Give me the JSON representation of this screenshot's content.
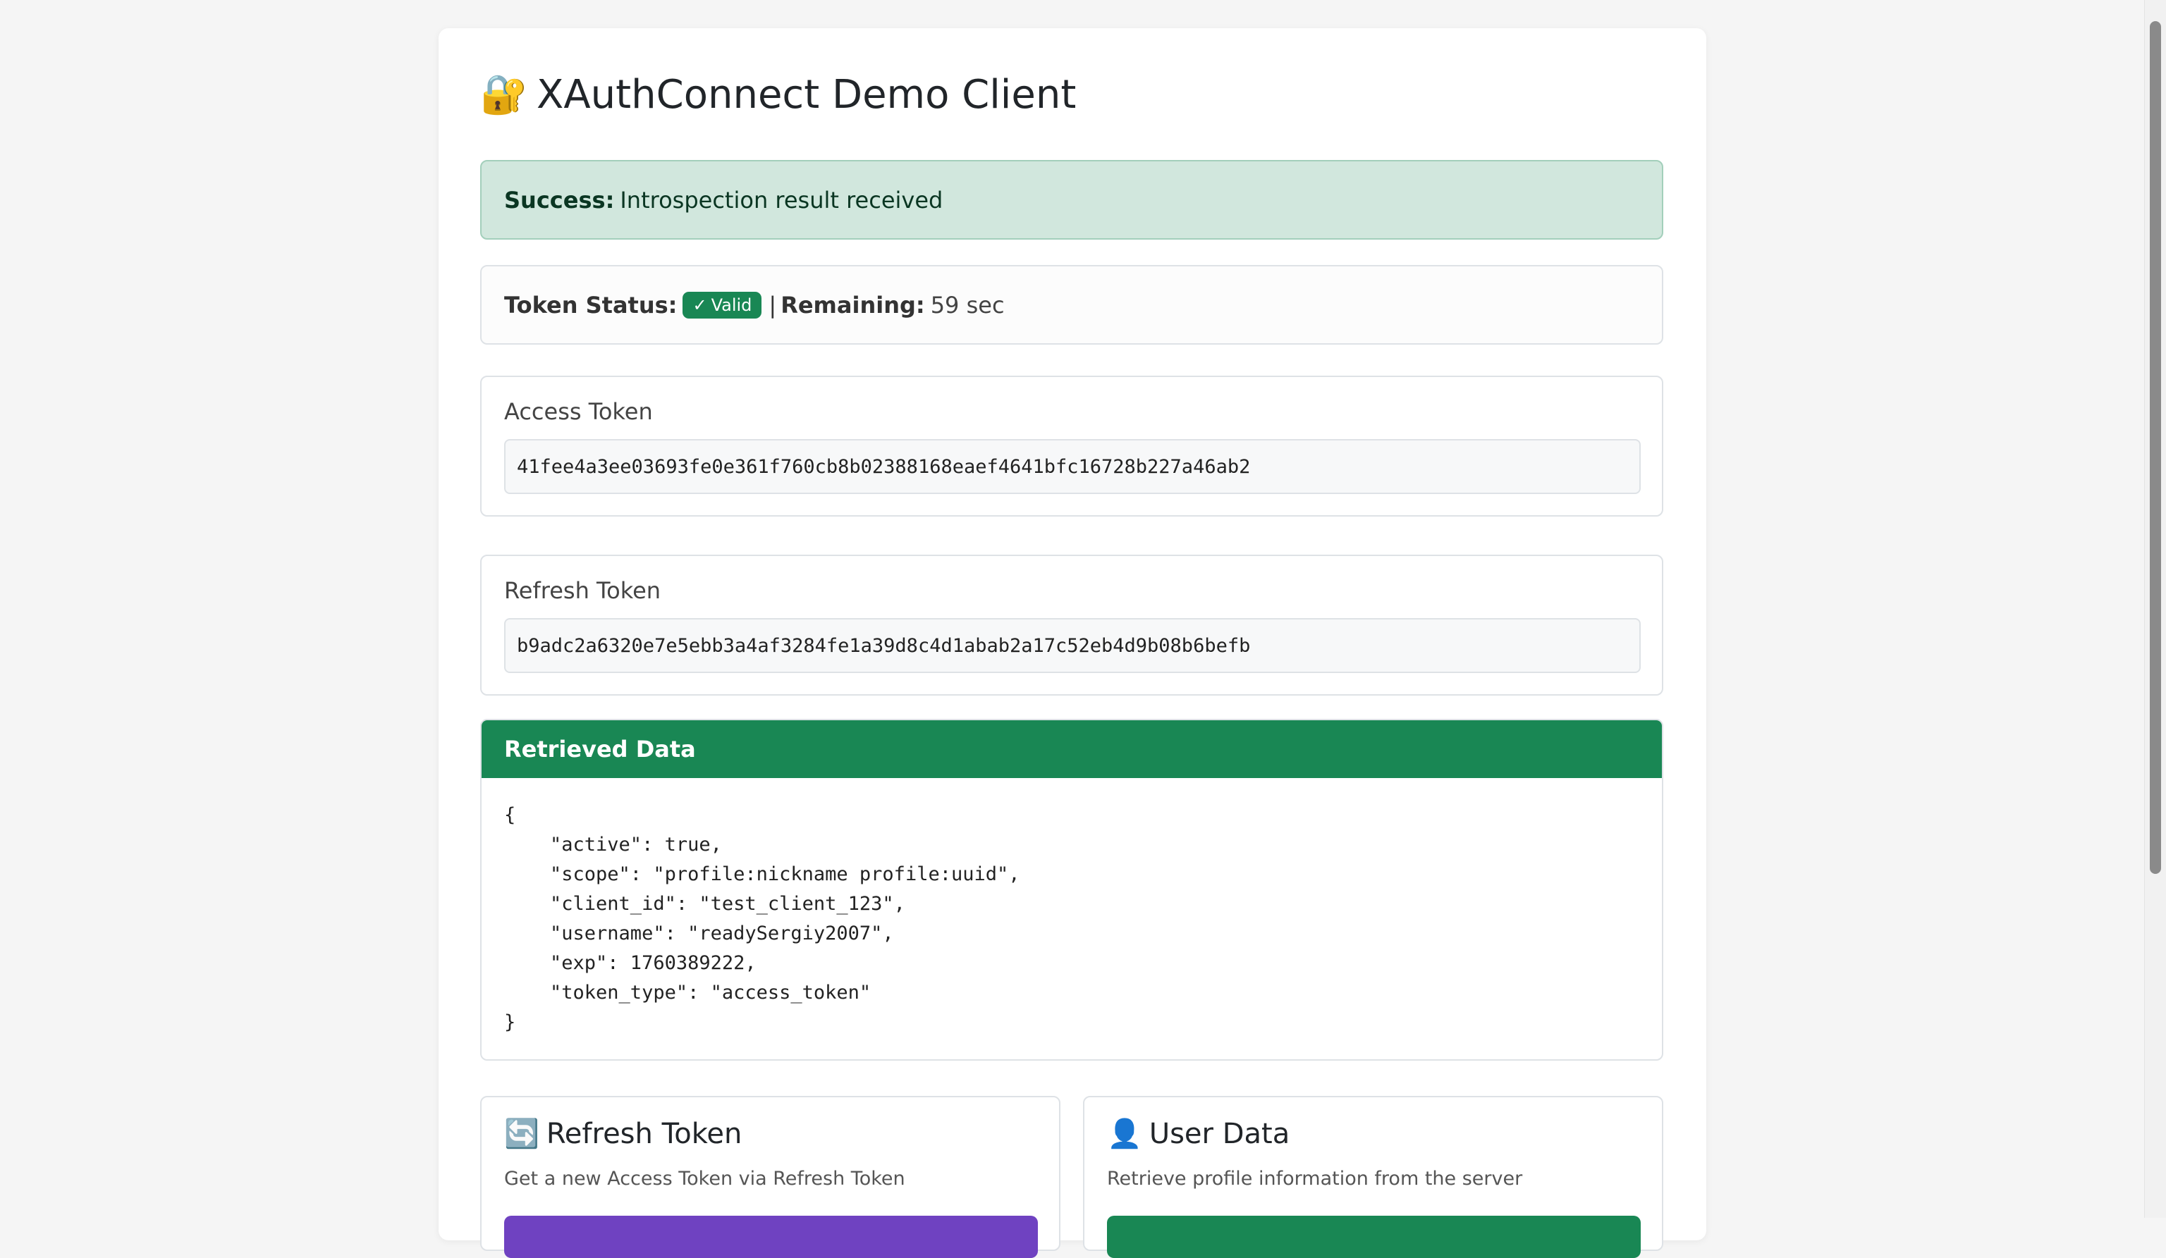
{
  "app": {
    "title": "XAuthConnect Demo Client",
    "title_icon": "🔐"
  },
  "alert": {
    "label": "Success:",
    "message": "Introspection result received"
  },
  "status": {
    "token_status_label": "Token Status:",
    "badge_check": "✓",
    "badge_text": "Valid",
    "separator": "|",
    "remaining_label": "Remaining:",
    "remaining_value": "59 sec"
  },
  "access_token": {
    "label": "Access Token",
    "value": "41fee4a3ee03693fe0e361f760cb8b02388168eaef4641bfc16728b227a46ab2"
  },
  "refresh_token": {
    "label": "Refresh Token",
    "value": "b9adc2a6320e7e5ebb3a4af3284fe1a39d8c4d1abab2a17c52eb4d9b08b6befb"
  },
  "retrieved": {
    "header": "Retrieved Data",
    "json": "{\n    \"active\": true,\n    \"scope\": \"profile:nickname profile:uuid\",\n    \"client_id\": \"test_client_123\",\n    \"username\": \"readySergiy2007\",\n    \"exp\": 1760389222,\n    \"token_type\": \"access_token\"\n}"
  },
  "actions": [
    {
      "icon": "🔄",
      "title": "Refresh Token",
      "description": "Get a new Access Token via Refresh Token",
      "button_color": "#6f42c1"
    },
    {
      "icon": "👤",
      "title": "User Data",
      "description": "Retrieve profile information from the server",
      "button_color": "#198754"
    }
  ],
  "colors": {
    "success": "#198754",
    "alert_bg": "#d1e7dd"
  }
}
